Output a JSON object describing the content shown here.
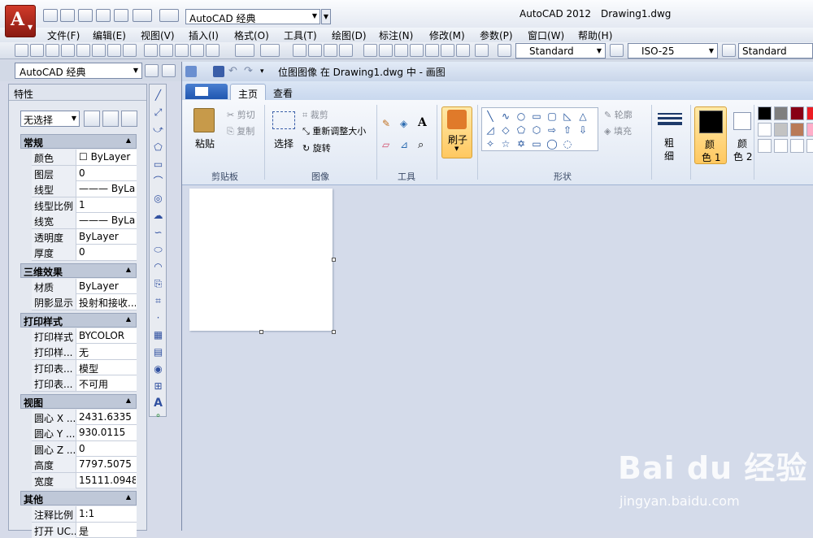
{
  "app": {
    "workspace": "AutoCAD 经典",
    "title": "AutoCAD 2012",
    "document": "Drawing1.dwg"
  },
  "menu": [
    "文件(F)",
    "编辑(E)",
    "视图(V)",
    "插入(I)",
    "格式(O)",
    "工具(T)",
    "绘图(D)",
    "标注(N)",
    "修改(M)",
    "参数(P)",
    "窗口(W)",
    "帮助(H)"
  ],
  "toolbar": {
    "text_style": "Standard",
    "dim_style": "ISO-25",
    "table_style": "Standard"
  },
  "workspace2": "AutoCAD 经典",
  "palette": {
    "title": "特性",
    "selection": "无选择",
    "sections": [
      {
        "name": "常规",
        "rows": [
          [
            "颜色",
            "☐ ByLayer"
          ],
          [
            "图层",
            "0"
          ],
          [
            "线型",
            "——— ByLa..."
          ],
          [
            "线型比例",
            "1"
          ],
          [
            "线宽",
            "——— ByLa..."
          ],
          [
            "透明度",
            "ByLayer"
          ],
          [
            "厚度",
            "0"
          ]
        ]
      },
      {
        "name": "三维效果",
        "rows": [
          [
            "材质",
            "ByLayer"
          ],
          [
            "阴影显示",
            "投射和接收..."
          ]
        ]
      },
      {
        "name": "打印样式",
        "rows": [
          [
            "打印样式",
            "BYCOLOR"
          ],
          [
            "打印样...",
            "无"
          ],
          [
            "打印表...",
            "模型"
          ],
          [
            "打印表...",
            "不可用"
          ]
        ]
      },
      {
        "name": "视图",
        "rows": [
          [
            "圆心 X ...",
            "2431.6335"
          ],
          [
            "圆心 Y ...",
            "930.0115"
          ],
          [
            "圆心 Z ...",
            "0"
          ],
          [
            "高度",
            "7797.5075"
          ],
          [
            "宽度",
            "15111.0948"
          ]
        ]
      },
      {
        "name": "其他",
        "rows": [
          [
            "注释比例",
            "1:1"
          ],
          [
            "打开 UC...",
            "是"
          ]
        ]
      }
    ]
  },
  "paint": {
    "title": "位图图像 在 Drawing1.dwg 中 - 画图",
    "tabs": {
      "home": "主页",
      "view": "查看"
    },
    "clipboard": {
      "paste": "粘贴",
      "cut": "剪切",
      "copy": "复制",
      "group": "剪贴板"
    },
    "image": {
      "select": "选择",
      "crop": "裁剪",
      "resize": "重新调整大小",
      "rotate": "旋转",
      "group": "图像"
    },
    "tools": {
      "group": "工具"
    },
    "brush": {
      "label": "刷子"
    },
    "shapes": {
      "outline": "轮廓",
      "fill": "填充",
      "group": "形状"
    },
    "size": {
      "label1": "粗",
      "label2": "细"
    },
    "color1": {
      "label1": "颜",
      "label2": "色 1"
    },
    "color2": {
      "label1": "颜",
      "label2": "色 2"
    },
    "palette_colors": [
      "#000000",
      "#7f7f7f",
      "#880015",
      "#ed1c24",
      "#ffffff",
      "#c3c3c3",
      "#b97a57",
      "#ffaec9",
      "#ffffff",
      "#ffffff",
      "#ffffff",
      "#ffffff"
    ]
  },
  "watermark": {
    "brand": "Bai du 经验",
    "url": "jingyan.baidu.com"
  }
}
